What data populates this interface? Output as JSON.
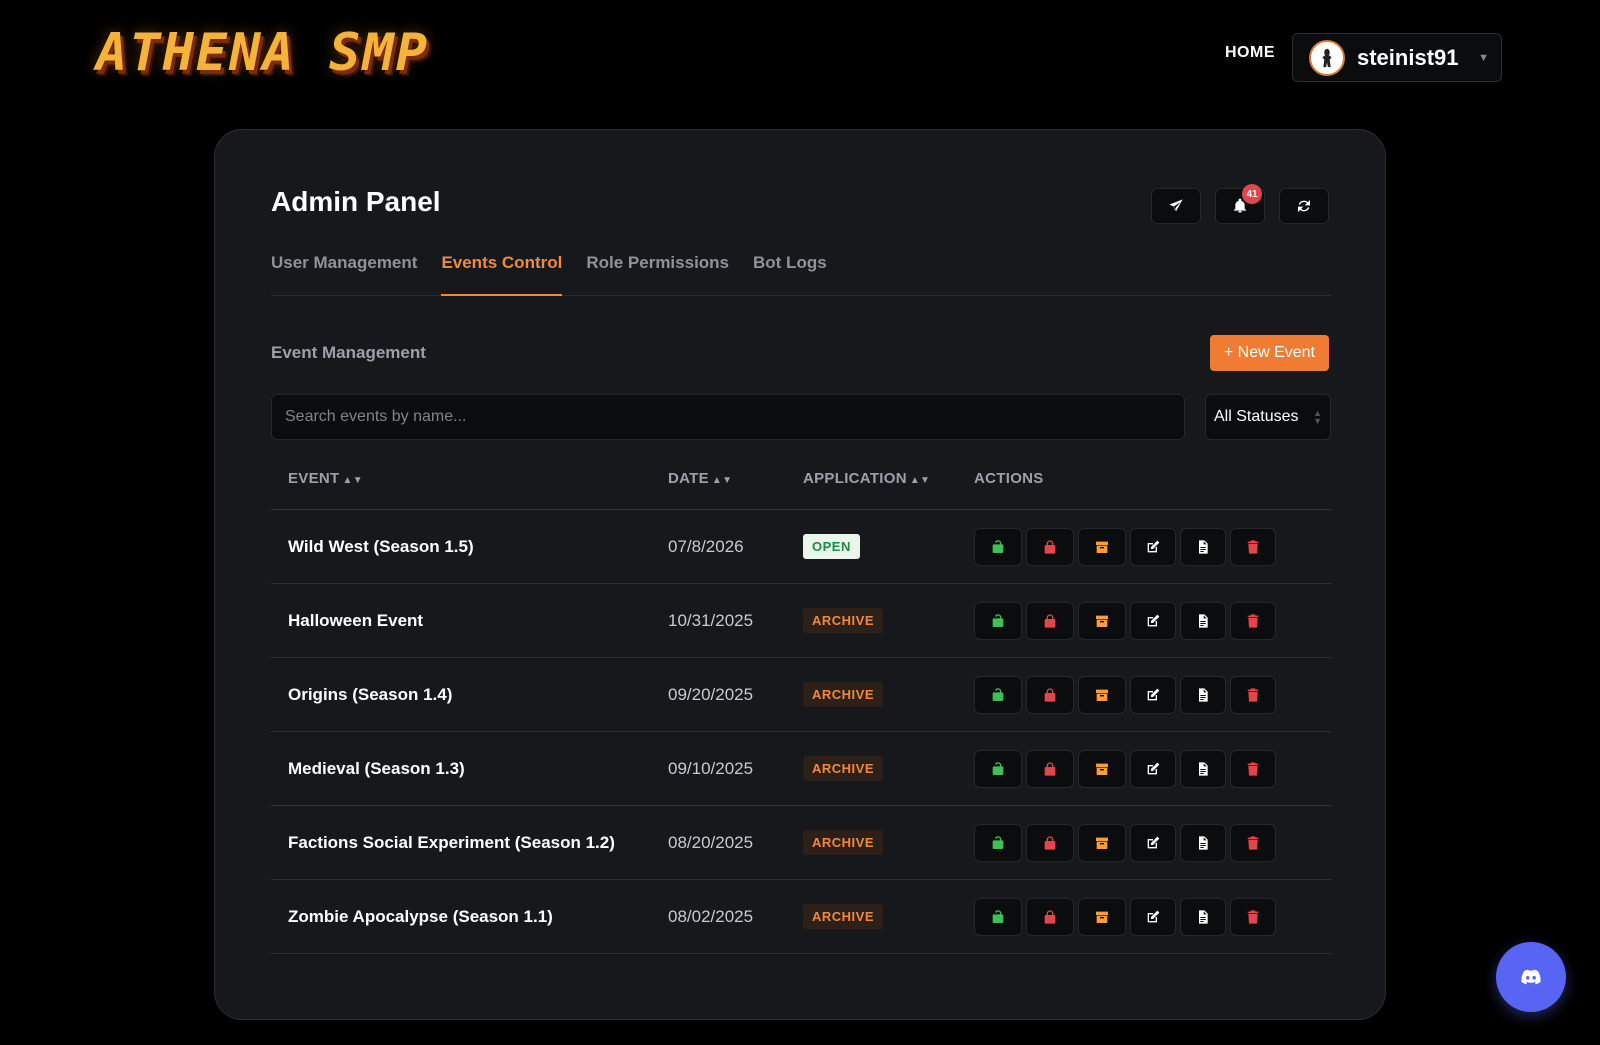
{
  "header": {
    "logo_text": "ATHENA SMP",
    "home_label": "HOME",
    "username": "steinist91"
  },
  "panel": {
    "title": "Admin Panel",
    "notification_count": "41",
    "tabs": [
      {
        "label": "User Management",
        "active": false
      },
      {
        "label": "Events Control",
        "active": true
      },
      {
        "label": "Role Permissions",
        "active": false
      },
      {
        "label": "Bot Logs",
        "active": false
      }
    ],
    "section_label": "Event Management",
    "new_event_label": "+ New Event",
    "search_placeholder": "Search events by name...",
    "status_filter": "All Statuses"
  },
  "table": {
    "headers": {
      "event": "EVENT",
      "date": "DATE",
      "application": "APPLICATION",
      "actions": "ACTIONS"
    },
    "rows": [
      {
        "event": "Wild West (Season 1.5)",
        "date": "07/8/2026",
        "application": "OPEN"
      },
      {
        "event": "Halloween Event",
        "date": "10/31/2025",
        "application": "ARCHIVE"
      },
      {
        "event": "Origins (Season 1.4)",
        "date": "09/20/2025",
        "application": "ARCHIVE"
      },
      {
        "event": "Medieval (Season 1.3)",
        "date": "09/10/2025",
        "application": "ARCHIVE"
      },
      {
        "event": "Factions Social Experiment (Season 1.2)",
        "date": "08/20/2025",
        "application": "ARCHIVE"
      },
      {
        "event": "Zombie Apocalypse (Season 1.1)",
        "date": "08/02/2025",
        "application": "ARCHIVE"
      }
    ]
  },
  "colors": {
    "accent": "#f08a3c",
    "open_green": "#1f8b3f",
    "unlock_green": "#3fbf57",
    "lock_red": "#e0474c",
    "archive_orange": "#f5a040",
    "discord": "#5865f2"
  },
  "icons": [
    "send-icon",
    "bell-icon",
    "refresh-icon",
    "unlock-icon",
    "lock-icon",
    "archive-icon",
    "edit-icon",
    "document-icon",
    "trash-icon",
    "discord-icon"
  ]
}
